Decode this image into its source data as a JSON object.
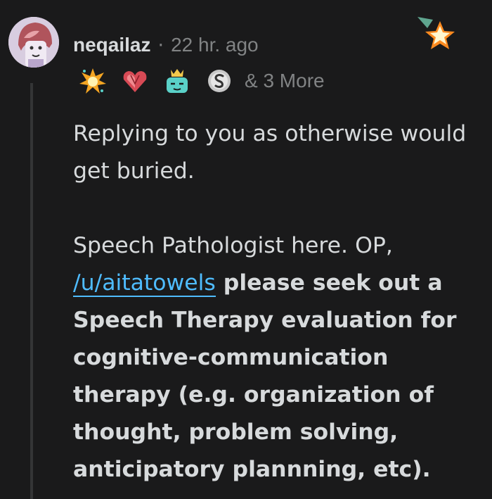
{
  "comment": {
    "username": "neqailaz",
    "separator": "·",
    "timestamp": "22 hr. ago",
    "flairs": [
      {
        "icon": "explosion-award-icon"
      },
      {
        "icon": "heart-gem-award-icon"
      },
      {
        "icon": "crowned-face-award-icon"
      },
      {
        "icon": "silver-coin-award-icon"
      }
    ],
    "more_awards": "& 3 More",
    "paragraph1": "Replying to you as otherwise would get buried.",
    "paragraph2_lead": "Speech Pathologist here. OP, ",
    "paragraph2_link": "/u/aitatowels",
    "paragraph2_bold": " please seek out a Speech Therapy evaluation for cognitive-communication therapy (e.g. organization of thought, problem solving, anticipatory plannning, etc)."
  },
  "colors": {
    "background": "#1a1a1b",
    "text": "#d7dadc",
    "meta": "#818384",
    "link": "#4fbcff",
    "thread_line": "#343536"
  }
}
